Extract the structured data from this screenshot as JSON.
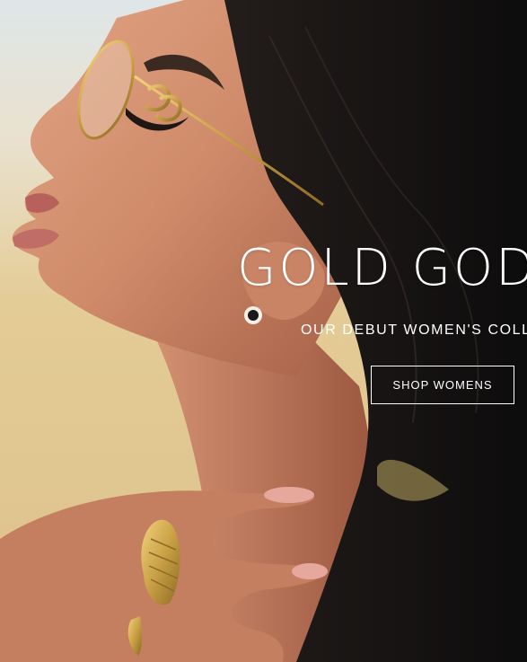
{
  "hero": {
    "headline": "GOLD GOD",
    "subheadline": "OUR DEBUT WOMEN'S COLLE",
    "cta_label": "SHOP WOMENS"
  },
  "colors": {
    "text": "#ffffff",
    "hair": "#121212",
    "skin": "#d08d6c",
    "gold": "#c9a045",
    "background_sand": "#e3c98f",
    "sky": "#dbe6ea"
  }
}
